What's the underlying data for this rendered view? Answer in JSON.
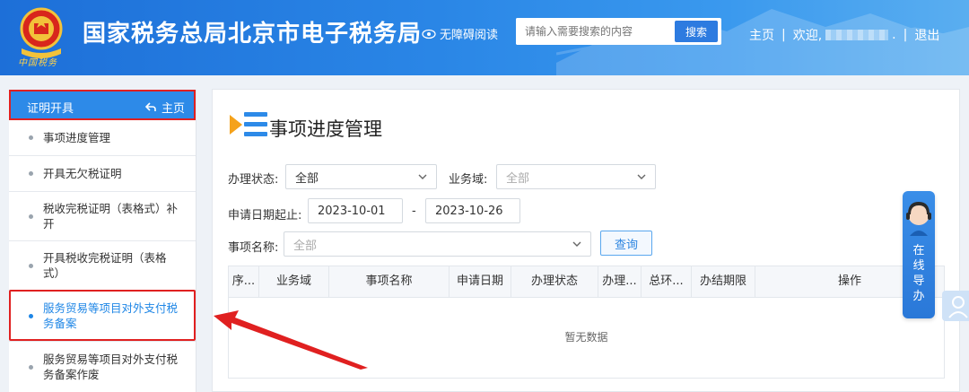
{
  "header": {
    "emblem_script": "中国税务",
    "site_title": "国家税务总局北京市电子税务局",
    "accessibility": "无障碍阅读",
    "search_placeholder": "请输入需要搜索的内容",
    "search_button": "搜索",
    "nav": {
      "home": "主页",
      "welcome": "欢迎,",
      "tail": ".",
      "logout": "退出"
    }
  },
  "sidebar": {
    "title": "证明开具",
    "home": "主页",
    "items": [
      {
        "label": "事项进度管理"
      },
      {
        "label": "开具无欠税证明"
      },
      {
        "label": "税收完税证明（表格式）补开"
      },
      {
        "label": "开具税收完税证明（表格式）"
      },
      {
        "label": "服务贸易等项目对外支付税务备案",
        "active": true
      },
      {
        "label": "服务贸易等项目对外支付税务备案作废"
      }
    ]
  },
  "main": {
    "title": "事项进度管理",
    "filters": {
      "status_label": "办理状态:",
      "status_value": "全部",
      "domain_label": "业务域:",
      "domain_placeholder": "全部",
      "date_label": "申请日期起止:",
      "date_from": "2023-10-01",
      "date_to": "2023-10-26",
      "date_sep": "-",
      "item_label": "事项名称:",
      "item_placeholder": "全部",
      "query_button": "查询"
    },
    "table": {
      "columns": [
        "序...",
        "业务域",
        "事项名称",
        "申请日期",
        "办理状态",
        "办理...",
        "总环...",
        "办结期限",
        "操作"
      ],
      "empty_text": "暂无数据"
    }
  },
  "guide": {
    "text": [
      "在",
      "线",
      "导",
      "办"
    ]
  },
  "colors": {
    "brand": "#2a86e6",
    "highlight": "#e02020",
    "active": "#1e86e6"
  }
}
